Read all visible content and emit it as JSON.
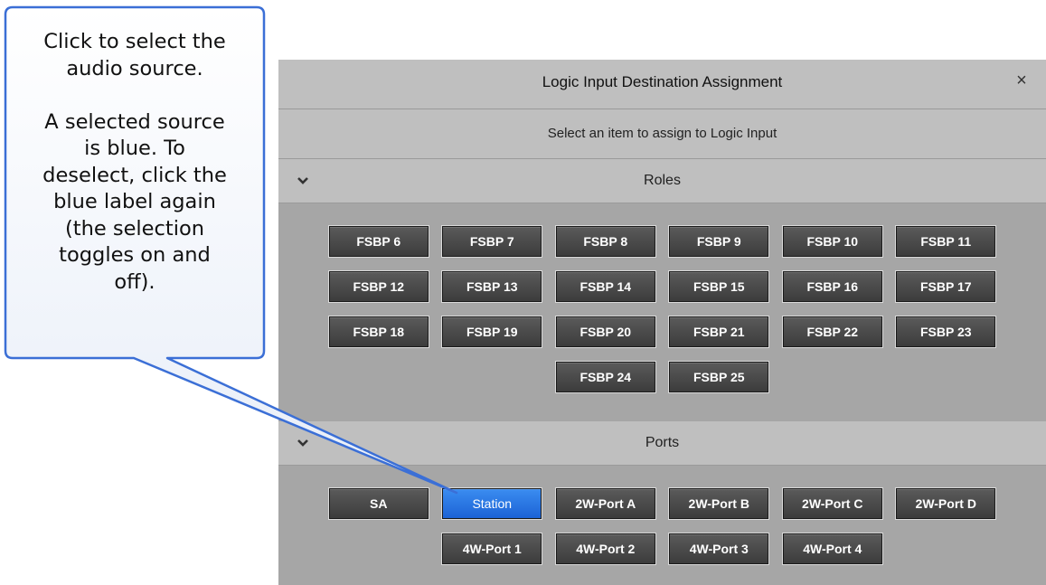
{
  "dialog": {
    "title": "Logic Input Destination Assignment",
    "close_label": "×",
    "subtitle": "Select an item to assign to Logic Input"
  },
  "sections": {
    "roles": {
      "label": "Roles",
      "chevron": "❯",
      "buttons": [
        "FSBP 6",
        "FSBP 7",
        "FSBP 8",
        "FSBP 9",
        "FSBP 10",
        "FSBP 11",
        "FSBP 12",
        "FSBP 13",
        "FSBP 14",
        "FSBP 15",
        "FSBP 16",
        "FSBP 17",
        "FSBP 18",
        "FSBP 19",
        "FSBP 20",
        "FSBP 21",
        "FSBP 22",
        "FSBP 23",
        "FSBP 24",
        "FSBP 25"
      ]
    },
    "ports": {
      "label": "Ports",
      "chevron": "❯",
      "buttons": [
        "SA",
        "Station",
        "2W-Port A",
        "2W-Port B",
        "2W-Port C",
        "2W-Port D",
        "4W-Port 1",
        "4W-Port 2",
        "4W-Port 3",
        "4W-Port 4"
      ],
      "selected": "Station"
    }
  },
  "callout": {
    "text": "Click to select the\naudio source.\n\nA selected source\nis blue. To\ndeselect, click the\nblue label again\n(the selection\ntoggles on and\noff)."
  },
  "colors": {
    "selected": "#1c63d6",
    "button": "#4a4a4a",
    "callout_border": "#3b6fd6"
  }
}
